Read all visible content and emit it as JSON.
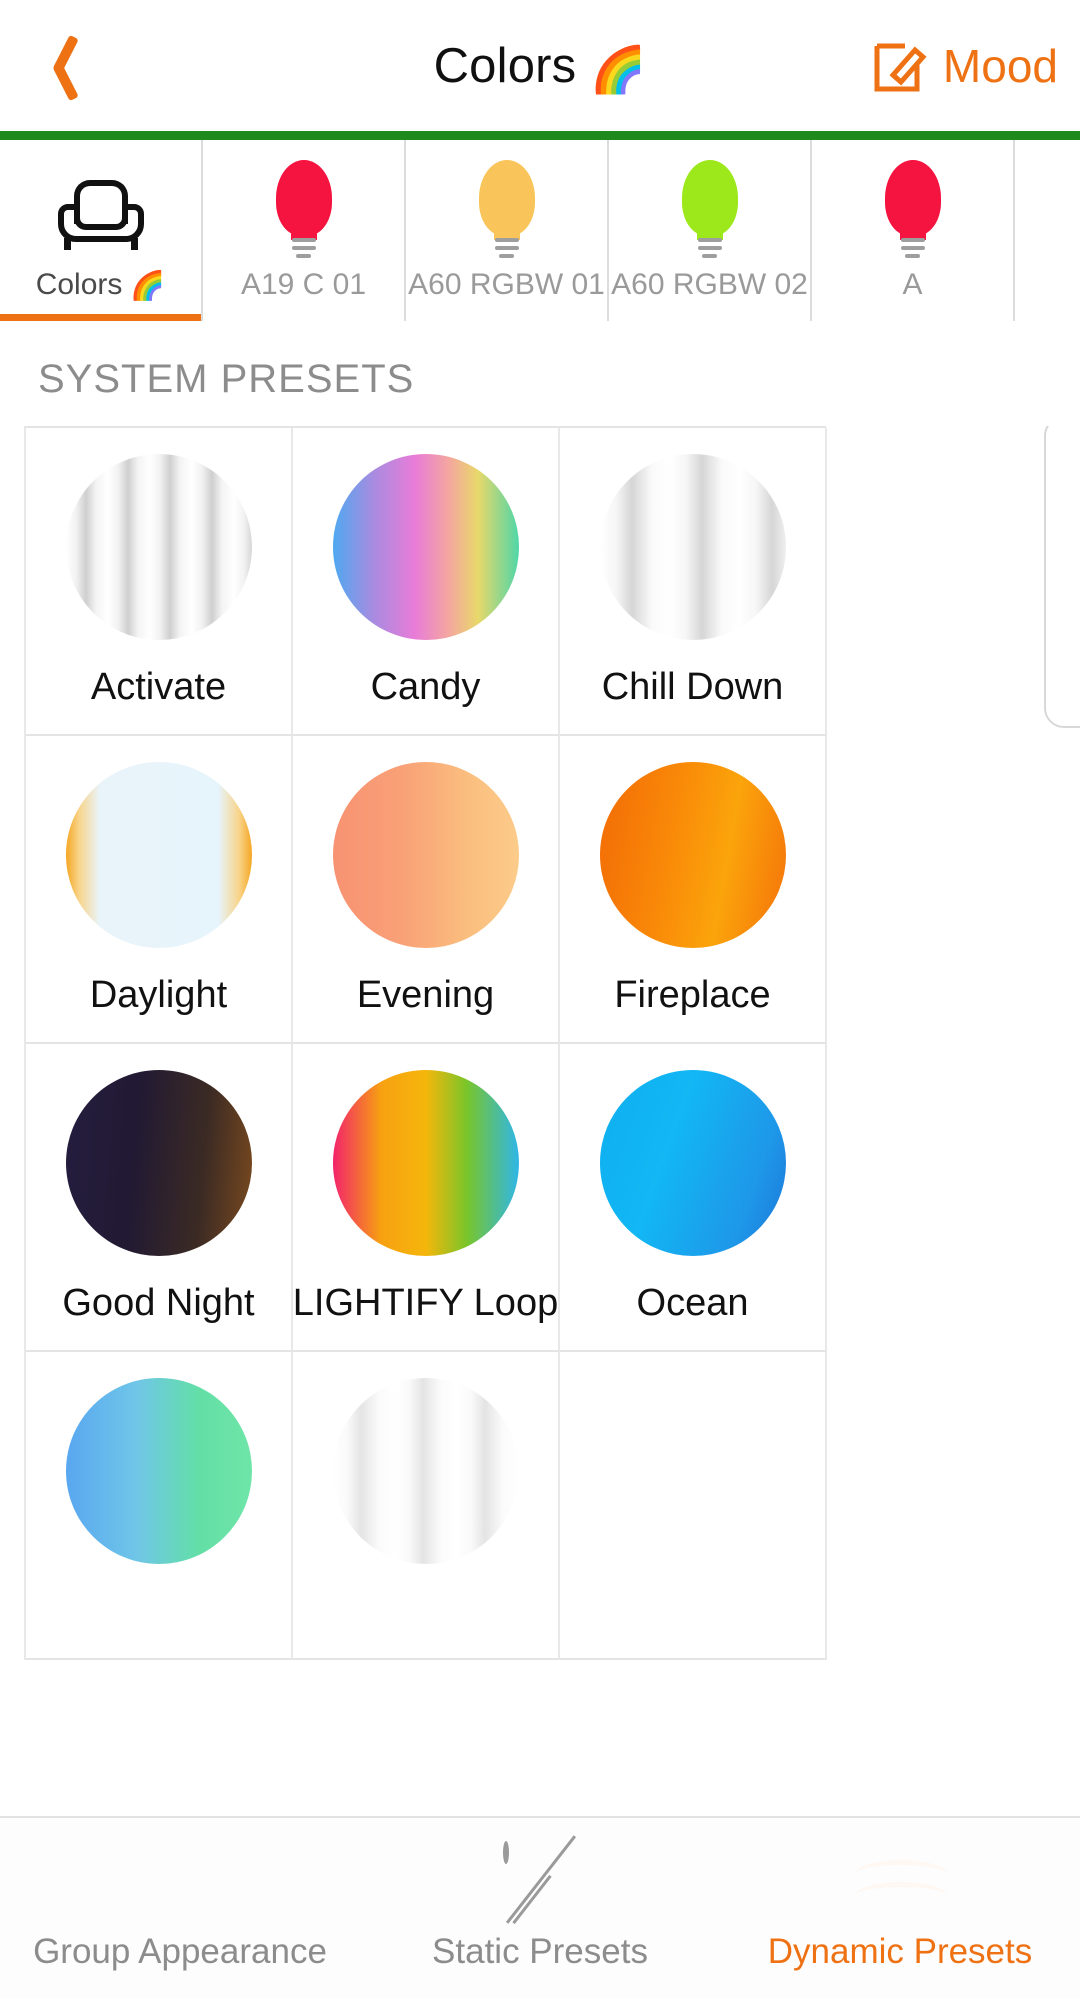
{
  "header": {
    "back_icon": "chevron-left-icon",
    "title": "Colors",
    "title_emoji": "🌈",
    "mood_label": "Mood",
    "mood_icon": "compose-edit-icon",
    "accent_color": "#EE7214",
    "rule_color": "#1E8A1E"
  },
  "device_tabs": [
    {
      "label": "Colors",
      "emoji": "🌈",
      "icon": "sofa-icon",
      "active": true,
      "bulb_color": ""
    },
    {
      "label": "A19 C 01",
      "emoji": "",
      "icon": "bulb-icon",
      "active": false,
      "bulb_color": "#F5133F"
    },
    {
      "label": "A60 RGBW 01",
      "emoji": "",
      "icon": "bulb-icon",
      "active": false,
      "bulb_color": "#F9C55A"
    },
    {
      "label": "A60 RGBW 02",
      "emoji": "",
      "icon": "bulb-icon",
      "active": false,
      "bulb_color": "#9CE81B"
    },
    {
      "label": "A",
      "emoji": "",
      "icon": "bulb-icon",
      "active": false,
      "bulb_color": "#F5133F"
    }
  ],
  "section": {
    "title": "SYSTEM PRESETS"
  },
  "presets": [
    {
      "name": "Activate",
      "gradient": "repeating-linear-gradient(90deg,#ffffff 0px,#f2f2f2 10px,#cfcfcf 20px,#f4f4f4 30px,#ffffff 42px)"
    },
    {
      "name": "Candy",
      "gradient": "linear-gradient(90deg,#4FA8F0 0%,#A98BE0 22%,#E87CD8 44%,#F4A6A0 62%,#E8D86A 78%,#4FD6A8 100%)"
    },
    {
      "name": "Chill Down",
      "gradient": "repeating-linear-gradient(90deg,#ffffff 0px,#f6f6f6 16px,#d6d6d6 32px,#fafafa 52px,#ffffff 70px)"
    },
    {
      "name": "Daylight",
      "gradient": "linear-gradient(90deg,#F5A623 0%,#F8D48A 7%,#E9F4FA 18%,#E6F4FB 82%,#F8D48A 93%,#F5A623 100%)"
    },
    {
      "name": "Evening",
      "gradient": "linear-gradient(90deg,#F79272 0%,#F9A177 38%,#FABE7E 72%,#FCCB8A 100%)"
    },
    {
      "name": "Fireplace",
      "gradient": "linear-gradient(100deg,#F26B06 0%,#F98908 38%,#FBA40B 66%,#F4720A 100%)"
    },
    {
      "name": "Good Night",
      "gradient": "linear-gradient(95deg,#241D3E 0%,#221A33 38%,#3B2A24 72%,#7A4A1E 100%)"
    },
    {
      "name": "LIGHTIFY Loop",
      "gradient": "linear-gradient(90deg,#F2246B 0%,#F7A111 26%,#F5B60B 50%,#79C52A 72%,#2FB6E8 100%)"
    },
    {
      "name": "Ocean",
      "gradient": "linear-gradient(110deg,#0FAEEF 0%,#12B7F4 38%,#1E97E8 78%,#1C74D8 100%)"
    },
    {
      "name": "",
      "gradient": "linear-gradient(90deg,#59A7F0 0%,#6FC6E8 38%,#63DFA6 72%,#6FE5A8 100%)"
    },
    {
      "name": "",
      "gradient": "repeating-linear-gradient(90deg,#ffffff 0px,#fafafa 14px,#e4e4e4 28px,#fbfbfb 46px,#ffffff 62px)"
    },
    {
      "name": "",
      "gradient": ""
    }
  ],
  "bottom_nav": [
    {
      "label": "Group Appearance",
      "icon": "group-appearance-icon",
      "active": false
    },
    {
      "label": "Static Presets",
      "icon": "static-presets-icon",
      "active": false
    },
    {
      "label": "Dynamic Presets",
      "icon": "dynamic-presets-icon",
      "active": true
    }
  ]
}
